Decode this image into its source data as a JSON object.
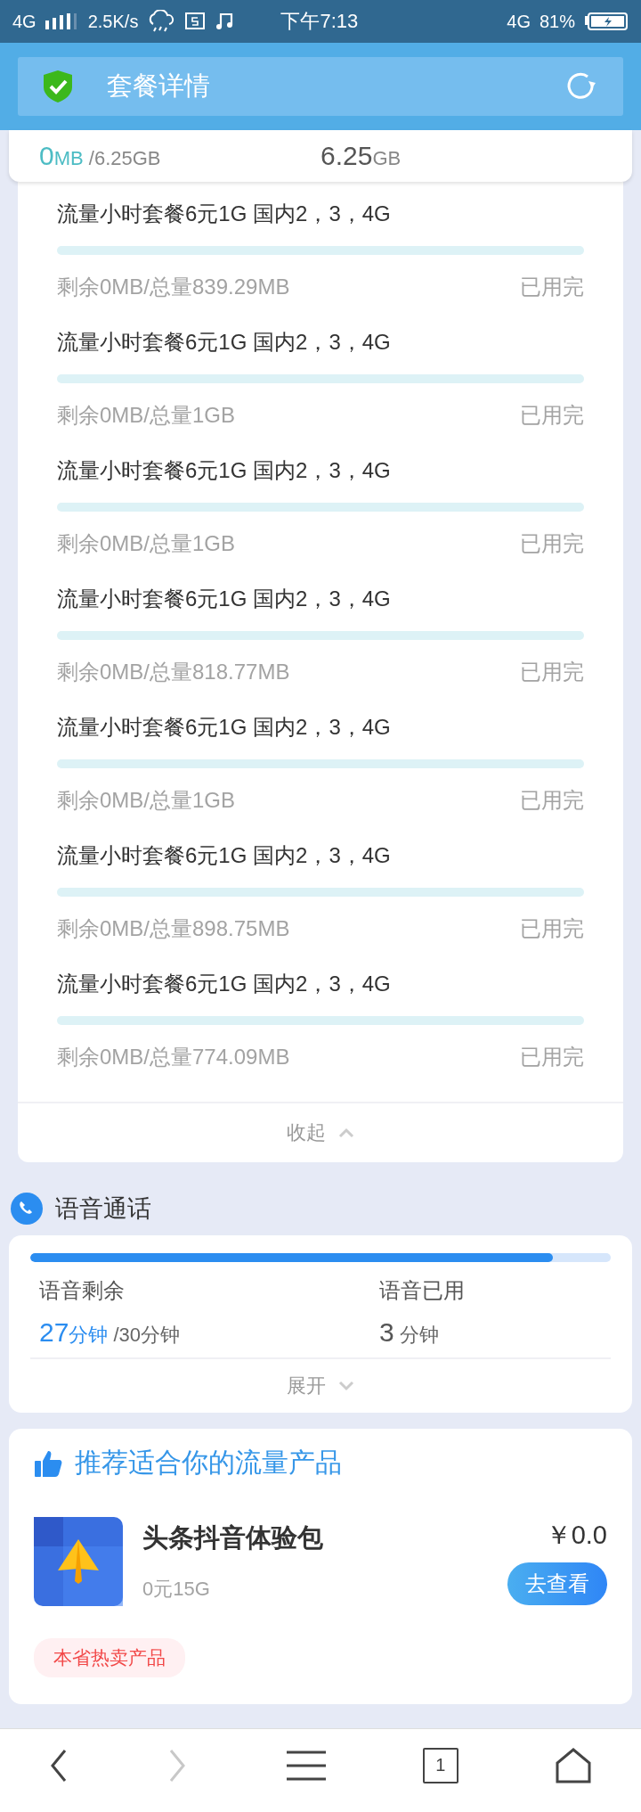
{
  "status_bar": {
    "network": "4G",
    "speed": "2.5K/s",
    "time": "下午7:13",
    "network_right": "4G",
    "battery": "81%"
  },
  "header": {
    "title": "套餐详情"
  },
  "data_summary": {
    "remaining": "0",
    "remaining_unit": "MB",
    "total": "/6.25GB",
    "used": "6.25",
    "used_unit": "GB"
  },
  "data_packages": [
    {
      "name": "流量小时套餐6元1G 国内2，3，4G",
      "level": 0,
      "remaining": "剩余0MB/总量839.29MB",
      "status": "已用完"
    },
    {
      "name": "流量小时套餐6元1G 国内2，3，4G",
      "level": 0,
      "remaining": "剩余0MB/总量1GB",
      "status": "已用完"
    },
    {
      "name": "流量小时套餐6元1G 国内2，3，4G",
      "level": 0,
      "remaining": "剩余0MB/总量1GB",
      "status": "已用完"
    },
    {
      "name": "流量小时套餐6元1G 国内2，3，4G",
      "level": 0,
      "remaining": "剩余0MB/总量818.77MB",
      "status": "已用完"
    },
    {
      "name": "流量小时套餐6元1G 国内2，3，4G",
      "level": 0,
      "remaining": "剩余0MB/总量1GB",
      "status": "已用完"
    },
    {
      "name": "流量小时套餐6元1G 国内2，3，4G",
      "level": 0,
      "remaining": "剩余0MB/总量898.75MB",
      "status": "已用完"
    },
    {
      "name": "流量小时套餐6元1G 国内2，3，4G",
      "level": 0,
      "remaining": "剩余0MB/总量774.09MB",
      "status": "已用完"
    }
  ],
  "collapse_toggle": {
    "label": "收起",
    "expanded": true
  },
  "voice": {
    "title": "语音通话",
    "level": 0.9,
    "remaining_label": "语音剩余",
    "remaining": "27",
    "remaining_unit": "分钟",
    "remaining_total": "/30分钟",
    "used_label": "语音已用",
    "used": "3",
    "used_unit": "分钟",
    "toggle": {
      "label": "展开",
      "expanded": false
    }
  },
  "recommend": {
    "title": "推荐适合你的流量产品",
    "product": {
      "name": "头条抖音体验包",
      "desc": "0元15G",
      "price": "￥0.0",
      "button": "去查看"
    },
    "tag": "本省热卖产品"
  },
  "nav": {
    "tab_count": "1",
    "forward_disabled": true
  }
}
